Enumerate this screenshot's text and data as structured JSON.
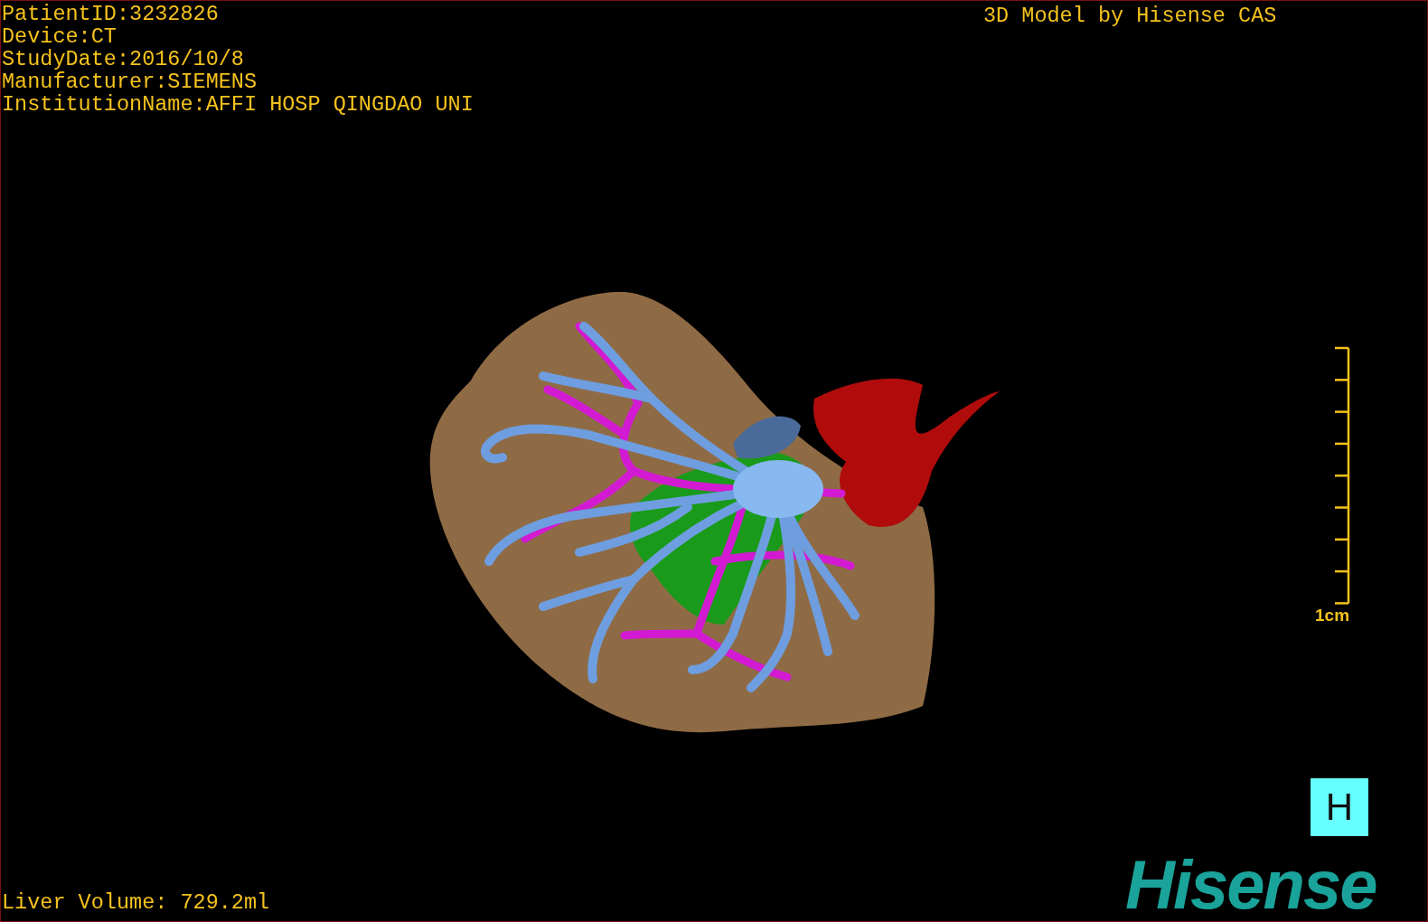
{
  "study_info": [
    "PatientID:3232826",
    "Device:CT",
    "StudyDate:2016/10/8",
    "Manufacturer:SIEMENS",
    "InstitutionName:AFFI HOSP QINGDAO UNI"
  ],
  "header_title": "3D Model by Hisense CAS",
  "scale_bar": {
    "label": "1cm"
  },
  "orientation_marker": {
    "label": "H"
  },
  "liver_volume": "Liver Volume: 729.2ml",
  "logo": "Hisense"
}
